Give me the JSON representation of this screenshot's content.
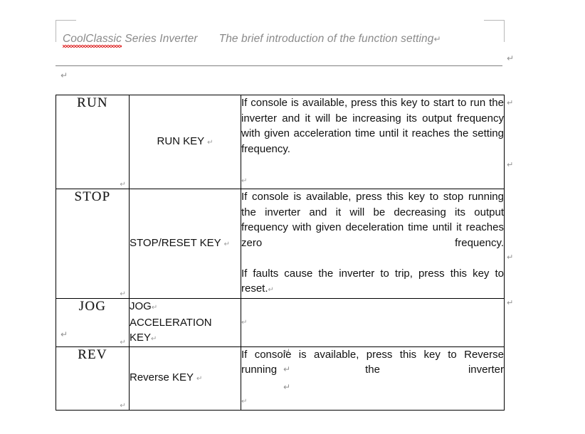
{
  "document": {
    "header": {
      "left_text_misspelled": "CoolClassic",
      "left_text_rest": " Series Inverter",
      "right_text": "The brief introduction of the function setting",
      "pilcrow": "↵"
    },
    "marks": {
      "pilcrow": "↵",
      "header_right_pilcrow": "↵",
      "below_header_pilcrow": "↵",
      "below_table_pilcrow": "↵",
      "tail_pilcrow_1": "↵",
      "tail_pilcrow_2": "↵",
      "tail_pilcrow_3": "↵"
    },
    "table": {
      "rows": [
        {
          "key": "RUN",
          "key_pilcrow": "↵",
          "name": "RUN KEY",
          "name_pilcrow": "↵",
          "name_align": "center",
          "description": "If console is available, press this key to start to run the inverter and it will be increasing its output frequency with given acceleration time until it reaches the setting frequency.",
          "description_pilcrow": "↵",
          "row_pilcrow": "↵"
        },
        {
          "key": "STOP",
          "key_pilcrow": "↵",
          "name": "STOP/RESET KEY",
          "name_pilcrow": "↵",
          "name_align": "middle-left",
          "description": "If console is available, press this key to stop running the inverter and it will be decreasing its output frequency with given deceleration time until it reaches zero frequency.",
          "description_pilcrow": "↵",
          "description2": "If faults cause the inverter to trip, press this key to reset.",
          "description2_pilcrow": "↵",
          "row_pilcrow": "↵"
        },
        {
          "key": "JOG",
          "key_pilcrow": "↵",
          "name": "JOG",
          "name_pilcrow": "↵",
          "name_line2": "ACCELERATION KEY",
          "name_line2_pilcrow": "↵",
          "name_align": "top-left",
          "description": "",
          "description_pilcrow": "↵",
          "row_pilcrow": "↵"
        },
        {
          "key": "REV",
          "key_pilcrow": "↵",
          "name": "Reverse KEY",
          "name_pilcrow": "↵",
          "name_align": "middle-left",
          "description": "If console is available, press this key to Reverse running the inverter",
          "description_pilcrow": "↵",
          "row_pilcrow": "↵"
        }
      ]
    }
  }
}
